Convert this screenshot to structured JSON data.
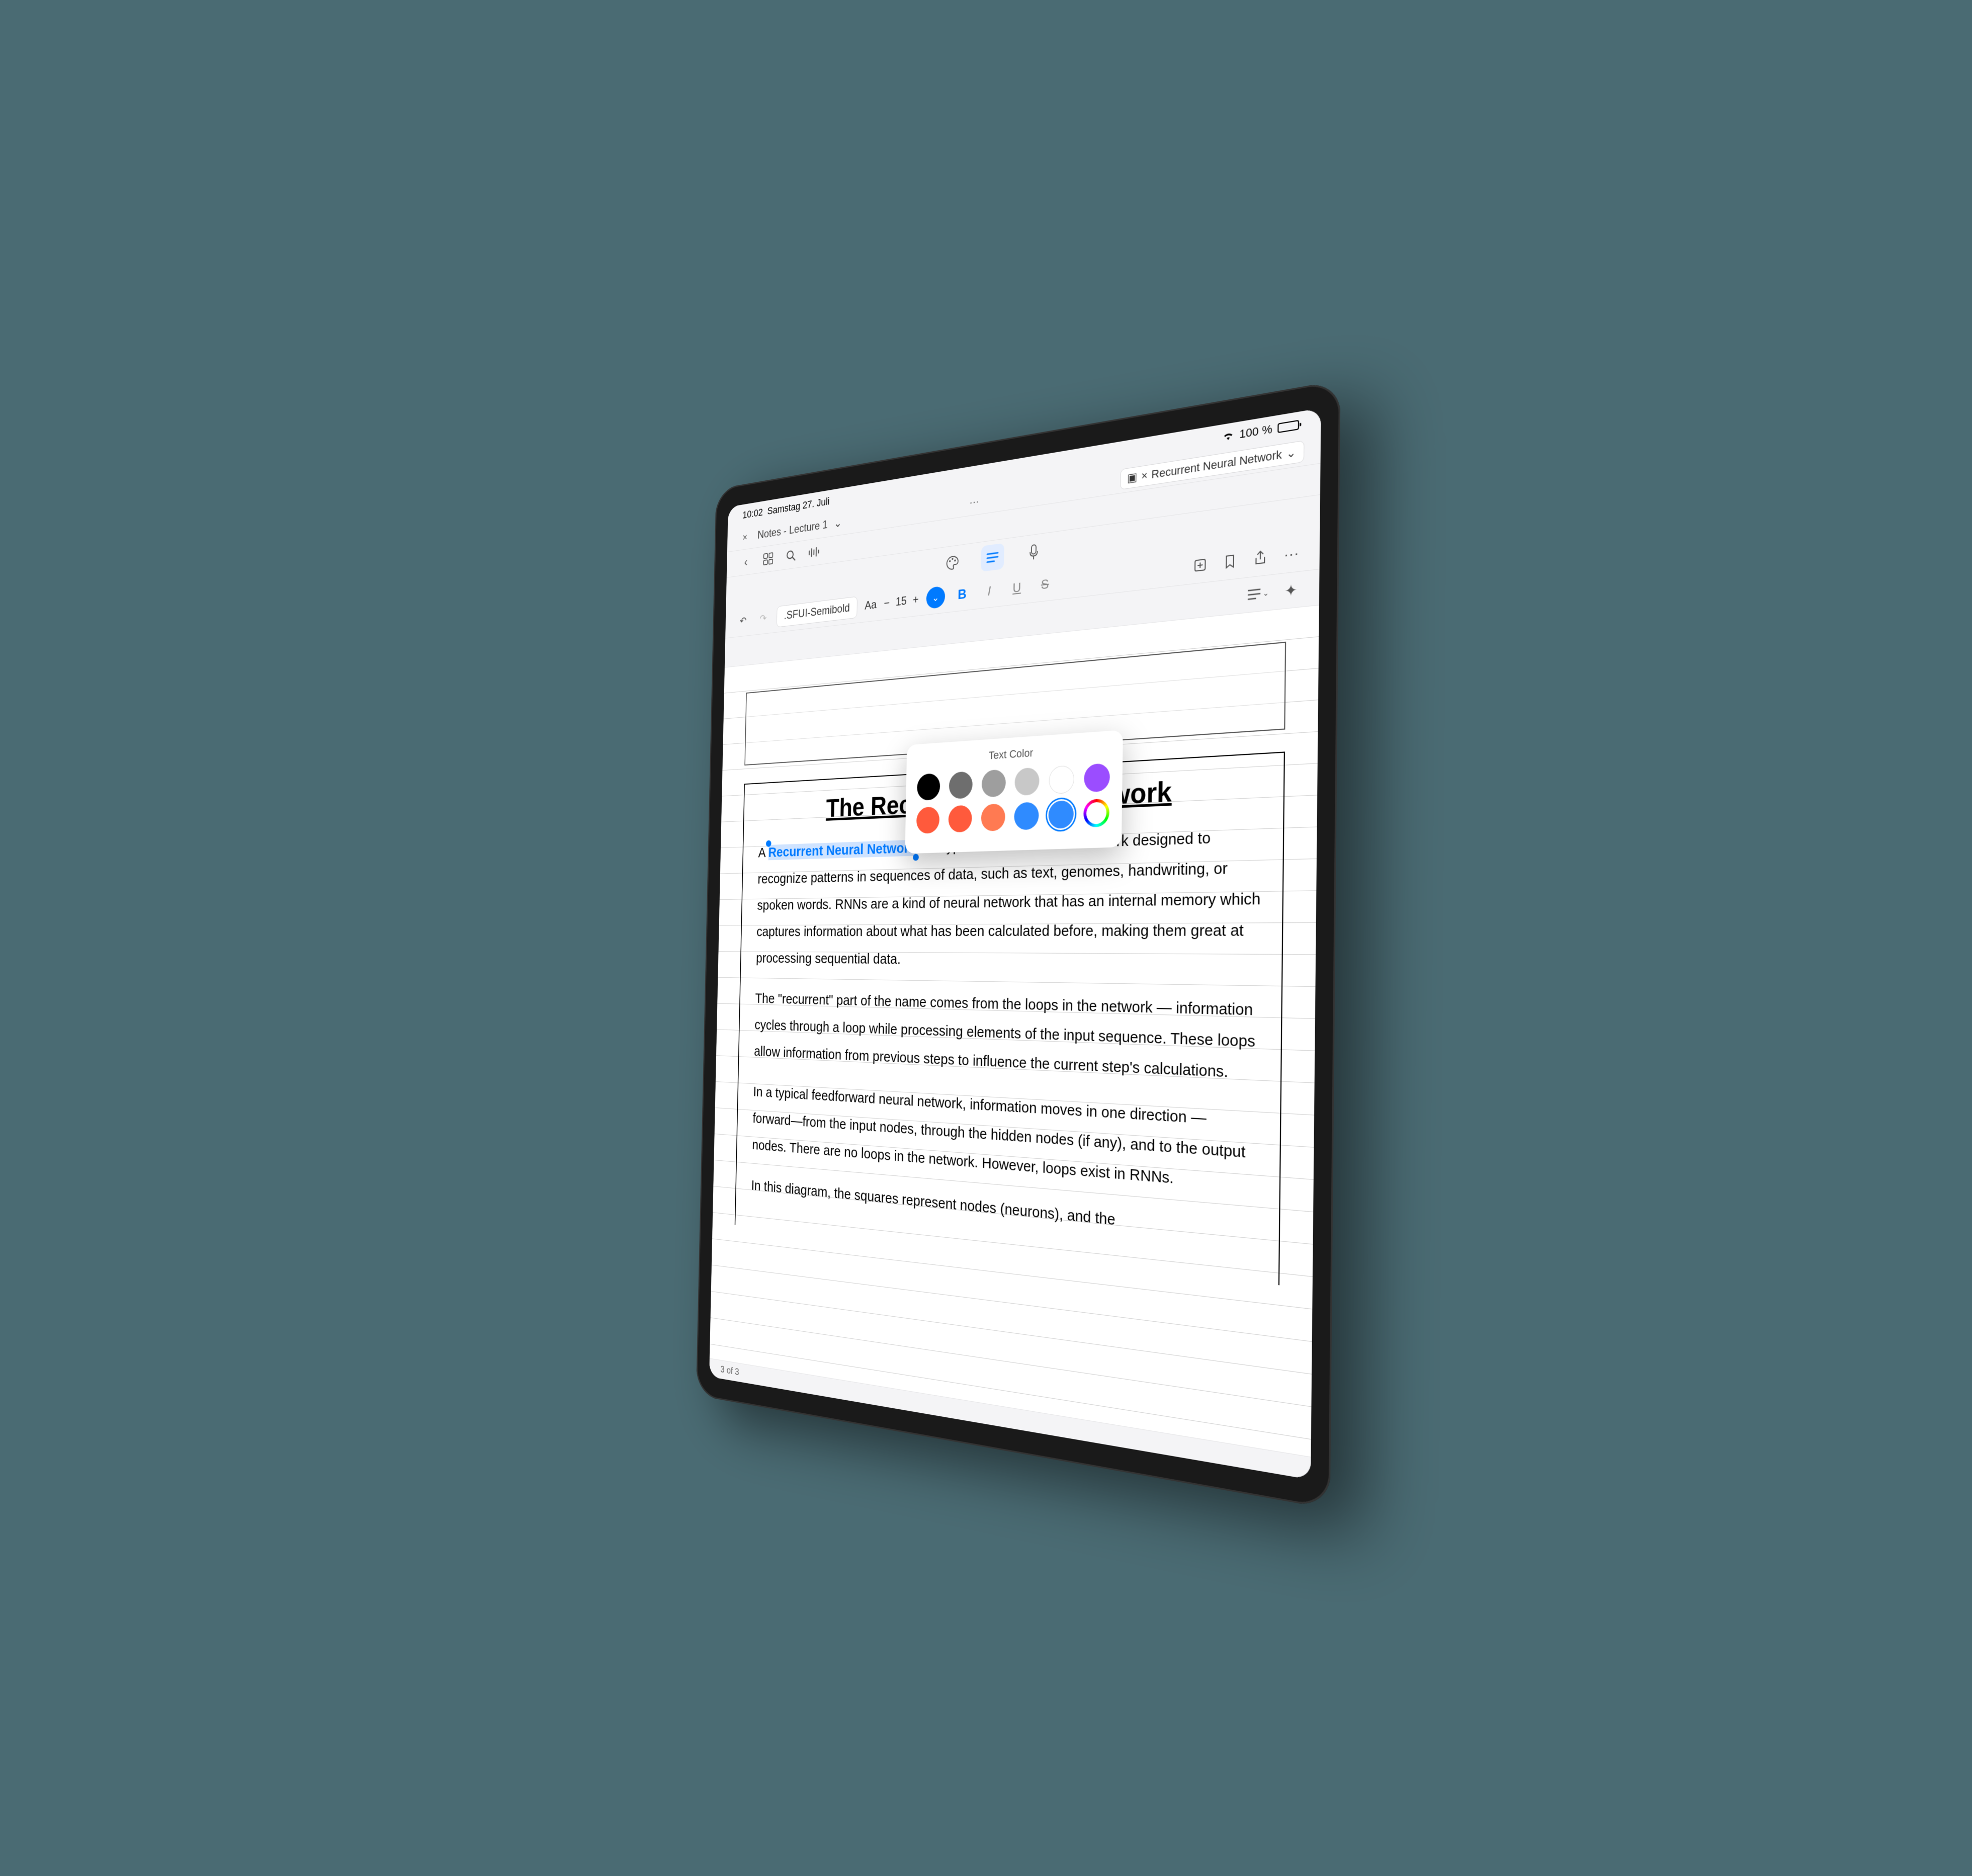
{
  "status": {
    "time": "10:02",
    "date": "Samstag 27. Juli",
    "wifi": "wifi-icon",
    "battery_pct": "100 %"
  },
  "tabs": {
    "left": {
      "close": "×",
      "title": "Notes - Lecture 1",
      "chevron": "⌄"
    },
    "right": {
      "close": "×",
      "title": "Recurrent Neural Network",
      "chevron": "⌄"
    },
    "overflow": "···"
  },
  "navbar": {
    "back": "‹",
    "grid": "grid-icon",
    "search": "search-icon",
    "audio": "waveform-icon"
  },
  "modebar": {
    "palette": "🎨",
    "text": "text-mode",
    "mic": "mic-icon"
  },
  "toolbar": {
    "undo": "↶",
    "redo": "↷",
    "font_name": ".SFUI-Semibold",
    "font_style_label": "Aa",
    "minus": "−",
    "font_size": "15",
    "plus": "+",
    "color_chevron": "⌄",
    "bold": "B",
    "italic": "I",
    "underline": "U",
    "strike": "S",
    "insert": "insert-icon",
    "bookmark": "bookmark-icon",
    "share": "share-icon",
    "more": "···",
    "paragraph": "paragraph-icon",
    "magic": "✦"
  },
  "popover": {
    "title": "Text Color",
    "row1": [
      "#000000",
      "#6e6e6e",
      "#9e9e9e",
      "#c8c8c8",
      "#ffffff",
      "#9b4dff"
    ],
    "row2": [
      "#ff5a3c",
      "#ff5a3c",
      "#ff7a52",
      "#2f8bff",
      "#2f8bff",
      "custom"
    ],
    "selected_index": [
      1,
      4
    ]
  },
  "document": {
    "title": "The Recurrent Neural Network",
    "p1_prefix": "A ",
    "p1_selected": "Recurrent Neural Network",
    "p1_rest": " is a type of artificial neural network designed to recognize patterns in sequences of data, such as text, genomes, handwriting, or spoken words. RNNs are a kind of neural network that has an internal memory which captures information about what has been calculated before, making them great at processing sequential data.",
    "p2": "The \"recurrent\" part of the name comes from the loops in the network — information cycles through a loop while processing elements of the input sequence. These loops allow information from previous steps to influence the current step's calculations.",
    "p3": "In a typical feedforward neural network, information moves in one direction —forward—from the input nodes, through the hidden nodes (if any), and to the output nodes. There are no loops in the network. However, loops exist in RNNs.",
    "p4": "In this diagram, the squares represent nodes (neurons), and the"
  },
  "footer": {
    "page": "3 of  3"
  }
}
